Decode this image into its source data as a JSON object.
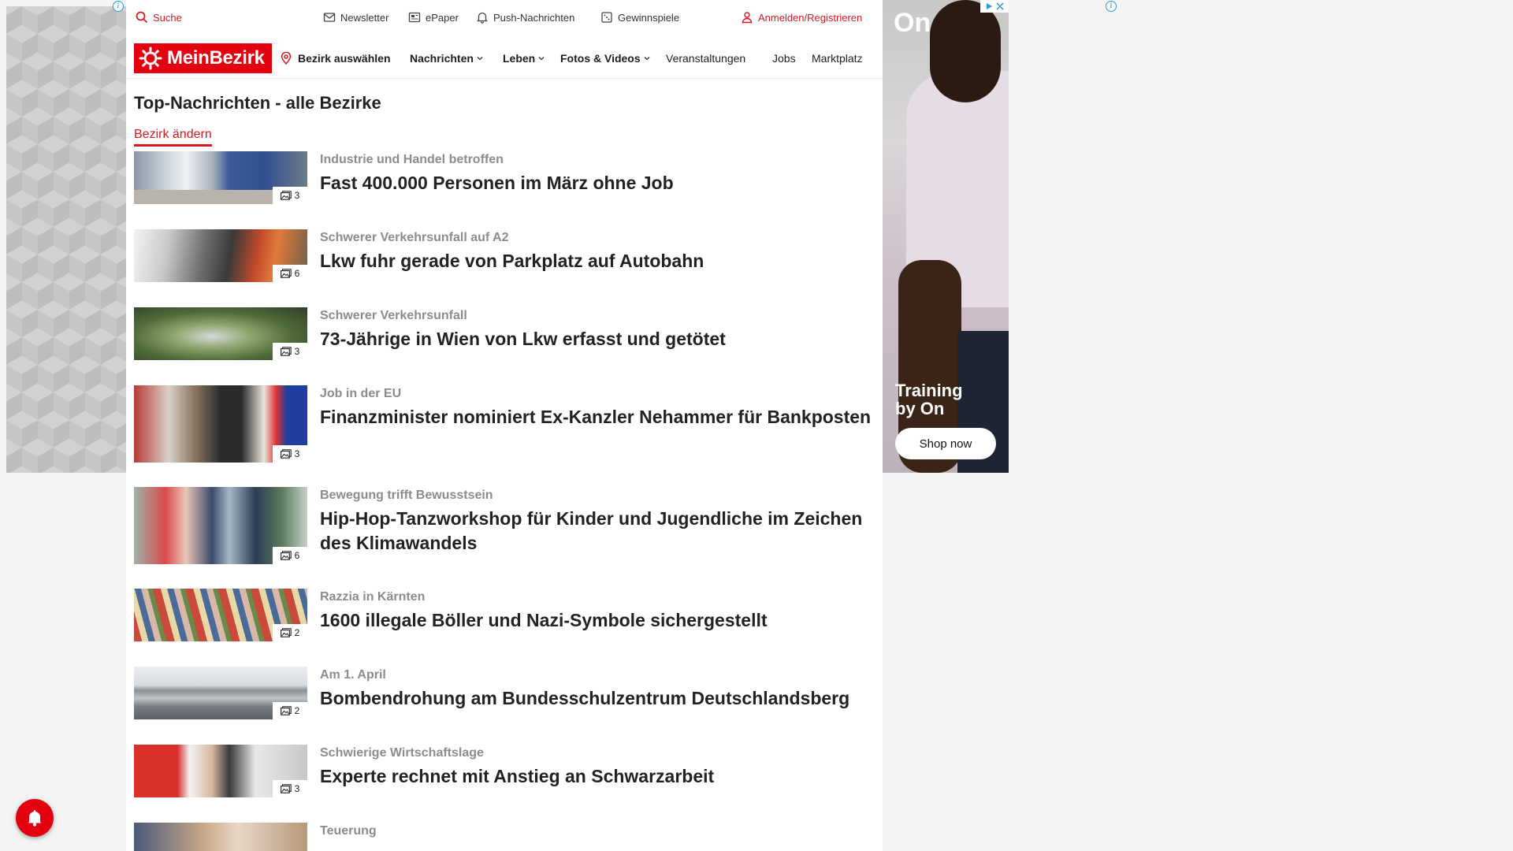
{
  "topbar": {
    "search_label": "Suche",
    "newsletter_label": "Newsletter",
    "epaper_label": "ePaper",
    "push_label": "Push-Nachrichten",
    "games_label": "Gewinnspiele",
    "login_label": "Anmelden/Registrieren"
  },
  "nav": {
    "logo_text": "MeinBezirk",
    "district_label": "Bezirk auswählen",
    "items": [
      {
        "label": "Nachrichten"
      },
      {
        "label": "Leben"
      },
      {
        "label": "Fotos & Videos"
      },
      {
        "label": "Veranstaltungen"
      },
      {
        "label": "Jobs"
      },
      {
        "label": "Marktplatz"
      }
    ]
  },
  "main": {
    "heading": "Top-Nachrichten - alle Bezirke",
    "change_district": "Bezirk ändern",
    "articles": [
      {
        "kicker": "Industrie und Handel betroffen",
        "title": "Fast 400.000 Personen im März ohne Job",
        "images": "3"
      },
      {
        "kicker": "Schwerer Verkehrsunfall auf A2",
        "title": "Lkw fuhr gerade von Parkplatz auf Autobahn",
        "images": "6"
      },
      {
        "kicker": "Schwerer Verkehrsunfall",
        "title": "73-Jährige in Wien von Lkw erfasst und getötet",
        "images": "3"
      },
      {
        "kicker": "Job in der EU",
        "title": "Finanzminister nominiert Ex-Kanzler Nehammer für Bankposten",
        "images": "3"
      },
      {
        "kicker": "Bewegung trifft Bewusstsein",
        "title": "Hip-Hop-Tanzworkshop für Kinder und Jugendliche im Zeichen des Klimawandels",
        "images": "6"
      },
      {
        "kicker": "Razzia in Kärnten",
        "title": "1600 illegale Böller und Nazi-Symbole sichergestellt",
        "images": "2"
      },
      {
        "kicker": "Am 1. April",
        "title": "Bombendrohung am Bundesschulzentrum Deutschlandsberg",
        "images": "2"
      },
      {
        "kicker": "Schwierige Wirtschaftslage",
        "title": "Experte rechnet mit Anstieg an Schwarzarbeit",
        "images": "3"
      },
      {
        "kicker": "Teuerung",
        "title": "",
        "images": ""
      }
    ]
  },
  "ad_right": {
    "brand": "On",
    "headline": "Training by On",
    "cta": "Shop now"
  },
  "colors": {
    "brand_red": "#e3000f",
    "link_red": "#d71920",
    "kicker_gray": "#8c8c8c"
  },
  "icons": [
    "search-icon",
    "mail-icon",
    "newspaper-icon",
    "bell-icon",
    "gift-icon",
    "user-icon",
    "map-pin-icon",
    "chevron-down-icon",
    "gallery-icon",
    "ad-info-icon",
    "ad-choices-icon"
  ]
}
